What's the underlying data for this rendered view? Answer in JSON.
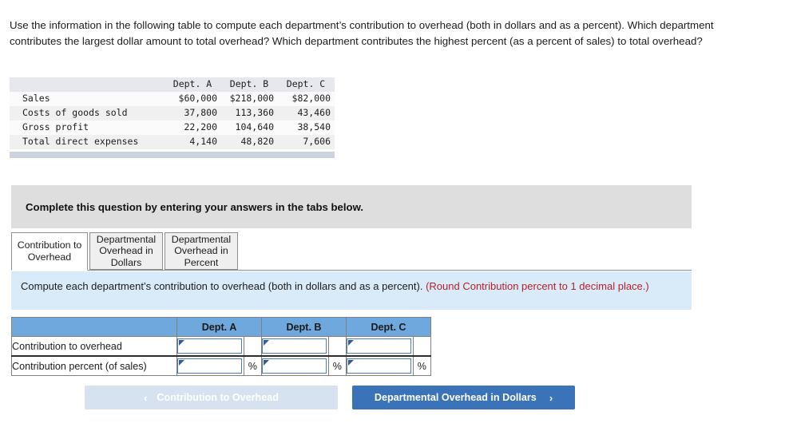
{
  "prompt": {
    "text": "Use the information in the following table to compute each department’s contribution to overhead (both in dollars and as a percent). Which department contributes the largest dollar amount to total overhead? Which department contributes the highest percent (as a percent of sales) to total overhead?"
  },
  "data_table": {
    "columns": [
      "",
      "Dept. A",
      "Dept. B",
      "Dept. C"
    ],
    "rows": [
      {
        "label": "Sales",
        "values": [
          "$60,000",
          "$218,000",
          "$82,000"
        ]
      },
      {
        "label": "Costs of goods sold",
        "values": [
          "37,800",
          "113,360",
          "43,460"
        ]
      },
      {
        "label": "Gross profit",
        "values": [
          "22,200",
          "104,640",
          "38,540"
        ]
      },
      {
        "label": "Total direct expenses",
        "values": [
          "4,140",
          "48,820",
          "7,606"
        ]
      }
    ]
  },
  "banner": {
    "text": "Complete this question by entering your answers in the tabs below."
  },
  "tabs": [
    {
      "label": "Contribution to Overhead",
      "active": true
    },
    {
      "label": "Departmental Overhead in Dollars",
      "active": false
    },
    {
      "label": "Departmental Overhead in Percent",
      "active": false
    }
  ],
  "instruction": {
    "main": "Compute each department’s contribution to overhead (both in dollars and as a percent).",
    "note": "(Round Contribution percent to 1 decimal place.)"
  },
  "answer_table": {
    "corner_header": "",
    "column_headers": [
      "Dept. A",
      "Dept. B",
      "Dept. C"
    ],
    "rows": [
      {
        "label": "Contribution to overhead",
        "cells": [
          {
            "value": "",
            "unit": ""
          },
          {
            "value": "",
            "unit": ""
          },
          {
            "value": "",
            "unit": ""
          }
        ]
      },
      {
        "label": "Contribution percent (of sales)",
        "cells": [
          {
            "value": "",
            "unit": "%"
          },
          {
            "value": "",
            "unit": "%"
          },
          {
            "value": "",
            "unit": "%"
          }
        ]
      }
    ]
  },
  "nav": {
    "prev_label": "Contribution to Overhead",
    "prev_icon": "chevron-left-icon",
    "prev_glyph": "‹",
    "next_label": "Departmental Overhead in Dollars",
    "next_icon": "chevron-right-icon",
    "next_glyph": "›"
  },
  "colors": {
    "header_blue": "#6fa8dc",
    "instruction_blue": "#d9ebf9",
    "banner_gray": "#dedede",
    "note_red": "#b4212b",
    "next_button_blue": "#3a73b8",
    "prev_button_blue": "#d6e2f0",
    "field_border_blue": "#4a7ebb"
  }
}
